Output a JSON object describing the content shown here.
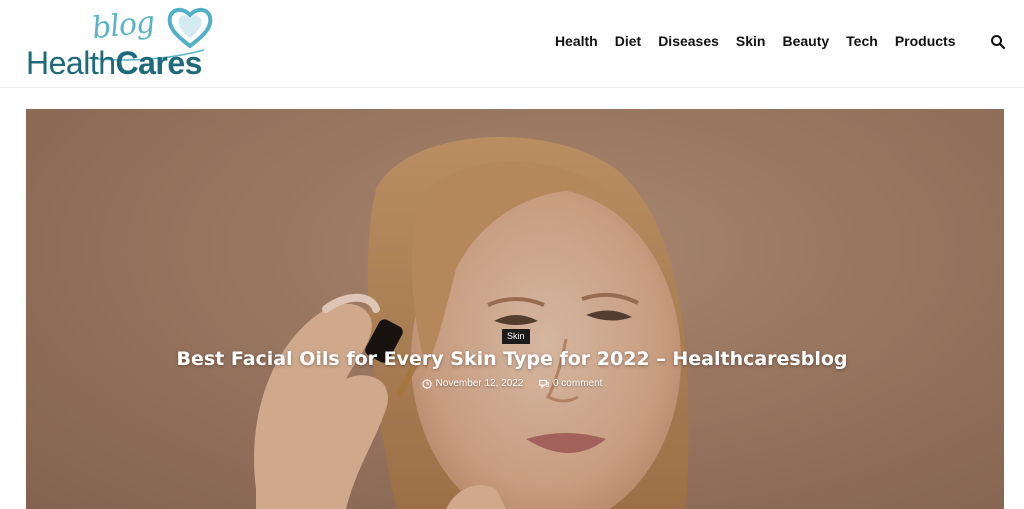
{
  "site": {
    "logo_script": "blog",
    "logo_word_health": "Health",
    "logo_word_cares": "Cares"
  },
  "nav": {
    "items": [
      {
        "label": "Health"
      },
      {
        "label": "Diet"
      },
      {
        "label": "Diseases"
      },
      {
        "label": "Skin"
      },
      {
        "label": "Beauty"
      },
      {
        "label": "Tech"
      },
      {
        "label": "Products"
      }
    ],
    "search_icon": "search-icon"
  },
  "hero": {
    "category": "Skin",
    "title": "Best Facial Oils for Every Skin Type for 2022 – Healthcaresblog",
    "date": "November 12, 2022",
    "comments": "0 comment",
    "clock_icon": "clock-icon",
    "comment_icon": "comment-icon"
  },
  "colors": {
    "brand_dark": "#1e6a7a",
    "brand_light": "#5bb3c9",
    "hero_bg": "#a78169"
  }
}
